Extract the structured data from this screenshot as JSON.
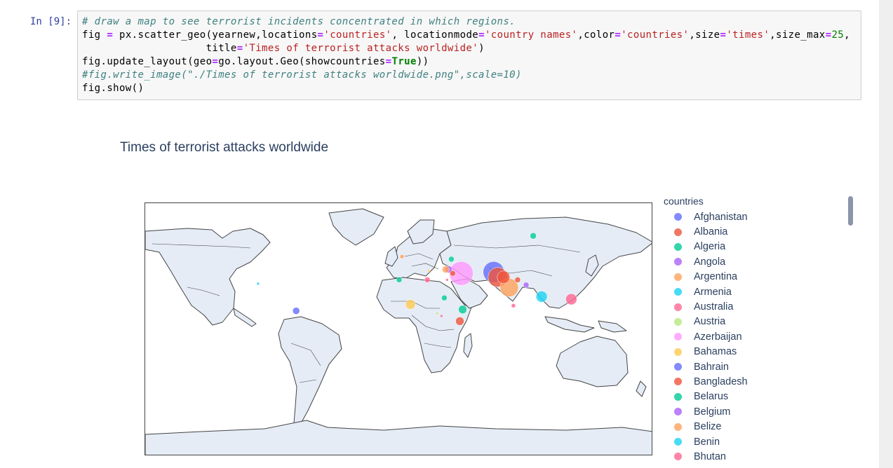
{
  "notebook": {
    "prompt": "In [9]:",
    "code": {
      "line1_comment": "# draw a map to see terrorist incidents concentrated in which regions.",
      "line2_a": "fig ",
      "line2_b": "=",
      "line2_c": " px.scatter_geo(yearnew,locations",
      "line2_d": "=",
      "line2_e": "'countries'",
      "line2_f": ", locationmode",
      "line2_g": "=",
      "line2_h": "'country names'",
      "line2_i": ",color",
      "line2_j": "=",
      "line2_k": "'countries'",
      "line2_l": ",size",
      "line2_m": "=",
      "line2_n": "'times'",
      "line2_o": ",size_max",
      "line2_p": "=",
      "line2_q": "25",
      "line2_r": ",",
      "line3_a": "                    title",
      "line3_b": "=",
      "line3_c": "'Times of terrorist attacks worldwide'",
      "line3_d": ")",
      "line4_a": "fig.update_layout(geo",
      "line4_b": "=",
      "line4_c": "go.layout.Geo(showcountries",
      "line4_d": "=",
      "line4_e": "True",
      "line4_f": "))",
      "line5_comment": "#fig.write_image(\"./Times of terrorist attacks worldwide.png\",scale=10)",
      "line6": "fig.show()"
    }
  },
  "chart_data": {
    "type": "scatter",
    "title": "Times of terrorist attacks worldwide",
    "legend_title": "countries",
    "legend_position": "right",
    "legend_scrollable": true,
    "projection": "equirectangular",
    "show_countries": true,
    "land_color": "#e5ecf6",
    "legend_items": [
      {
        "name": "Afghanistan",
        "color": "#636efa"
      },
      {
        "name": "Albania",
        "color": "#ef553b"
      },
      {
        "name": "Algeria",
        "color": "#00cc96"
      },
      {
        "name": "Angola",
        "color": "#ab63fa"
      },
      {
        "name": "Argentina",
        "color": "#ffa15a"
      },
      {
        "name": "Armenia",
        "color": "#19d3f3"
      },
      {
        "name": "Australia",
        "color": "#ff6692"
      },
      {
        "name": "Austria",
        "color": "#b6e880"
      },
      {
        "name": "Azerbaijan",
        "color": "#ff97ff"
      },
      {
        "name": "Bahamas",
        "color": "#fecb52"
      },
      {
        "name": "Bahrain",
        "color": "#636efa"
      },
      {
        "name": "Bangladesh",
        "color": "#ef553b"
      },
      {
        "name": "Belarus",
        "color": "#00cc96"
      },
      {
        "name": "Belgium",
        "color": "#ab63fa"
      },
      {
        "name": "Belize",
        "color": "#ffa15a"
      },
      {
        "name": "Benin",
        "color": "#19d3f3"
      },
      {
        "name": "Bhutan",
        "color": "#ff6692"
      }
    ],
    "points": [
      {
        "lon": 67,
        "lat": 34,
        "r": 15,
        "color": "#636efa"
      },
      {
        "lon": 44,
        "lat": 33,
        "r": 17,
        "color": "#ff97ff"
      },
      {
        "lon": 70,
        "lat": 30,
        "r": 14,
        "color": "#ef553b"
      },
      {
        "lon": 78,
        "lat": 22,
        "r": 13,
        "color": "#ffa15a"
      },
      {
        "lon": 74,
        "lat": 30,
        "r": 9,
        "color": "#ef553b"
      },
      {
        "lon": 90,
        "lat": 24,
        "r": 4,
        "color": "#ab63fa"
      },
      {
        "lon": 84,
        "lat": 28,
        "r": 4,
        "color": "#ef553b"
      },
      {
        "lon": 81,
        "lat": 8,
        "r": 3,
        "color": "#ff6692"
      },
      {
        "lon": 101,
        "lat": 15,
        "r": 8,
        "color": "#19d3f3"
      },
      {
        "lon": 122,
        "lat": 13,
        "r": 8,
        "color": "#ff6692"
      },
      {
        "lon": 45,
        "lat": 5,
        "r": 6,
        "color": "#00cc96"
      },
      {
        "lon": 43,
        "lat": -4,
        "r": 6,
        "color": "#ef553b"
      },
      {
        "lon": 37,
        "lat": 44,
        "r": 4,
        "color": "#00cc96"
      },
      {
        "lon": 95,
        "lat": 62,
        "r": 4.5,
        "color": "#00cc96"
      },
      {
        "lon": 8,
        "lat": 9,
        "r": 7,
        "color": "#fecb52"
      },
      {
        "lon": 32,
        "lat": 14,
        "r": 4,
        "color": "#00cc96"
      },
      {
        "lon": 20,
        "lat": 28,
        "r": 4,
        "color": "#ff6692"
      },
      {
        "lon": 35,
        "lat": 36,
        "r": 5,
        "color": "#ab63fa"
      },
      {
        "lon": 33,
        "lat": 36,
        "r": 5,
        "color": "#ffa15a"
      },
      {
        "lon": 38,
        "lat": 33,
        "r": 4,
        "color": "#ef553b"
      },
      {
        "lon": 0,
        "lat": 28,
        "r": 4,
        "color": "#00cc96"
      },
      {
        "lon": 34,
        "lat": 28,
        "r": 2,
        "color": "#ff6692"
      },
      {
        "lon": 2,
        "lat": 46,
        "r": 3,
        "color": "#ffa15a"
      },
      {
        "lon": -73,
        "lat": 4,
        "r": 5,
        "color": "#636efa"
      },
      {
        "lon": -100,
        "lat": 25,
        "r": 2,
        "color": "#19d3f3"
      },
      {
        "lon": 30,
        "lat": 0,
        "r": 2,
        "color": "#ff6692"
      },
      {
        "lon": 27,
        "lat": 2,
        "r": 2,
        "color": "#b6e880"
      },
      {
        "lon": 21,
        "lat": 35,
        "r": 2,
        "color": "#fecb52"
      }
    ]
  }
}
